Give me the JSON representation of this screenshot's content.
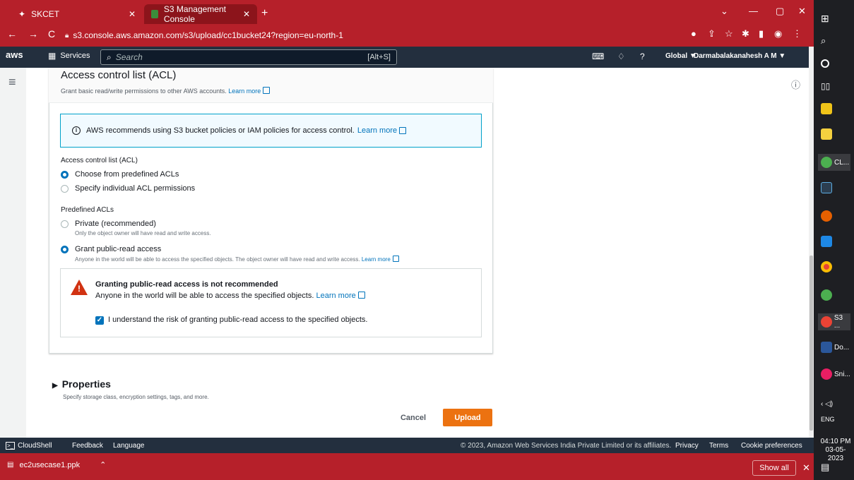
{
  "browser": {
    "tabs": [
      {
        "label": "SKCET"
      },
      {
        "label": "S3 Management Console"
      }
    ],
    "url": "s3.console.aws.amazon.com/s3/upload/cc1bucket24?region=eu-north-1"
  },
  "aws_nav": {
    "logo": "aws",
    "services_label": "Services",
    "search_placeholder": "Search",
    "search_shortcut": "[Alt+S]",
    "region": "Global ▼",
    "user": "Darmabalakanahesh A M ▼"
  },
  "acl": {
    "title": "Access control list (ACL)",
    "description": "Grant basic read/write permissions to other AWS accounts.",
    "learn_more": "Learn more",
    "info_text": "AWS recommends using S3 bucket policies or IAM policies for access control.",
    "acl_label": "Access control list (ACL)",
    "acl_options": [
      {
        "label": "Choose from predefined ACLs",
        "selected": true
      },
      {
        "label": "Specify individual ACL permissions",
        "selected": false
      }
    ],
    "predefined_label": "Predefined ACLs",
    "predefined_options": [
      {
        "label": "Private (recommended)",
        "sub": "Only the object owner will have read and write access.",
        "selected": false
      },
      {
        "label": "Grant public-read access",
        "sub": "Anyone in the world will be able to access the specified objects. The object owner will have read and write access.",
        "selected": true
      }
    ],
    "warning_title": "Granting public-read access is not recommended",
    "warning_text": "Anyone in the world will be able to access the specified objects.",
    "checkbox_label": "I understand the risk of granting public-read access to the specified objects.",
    "checkbox_checked": true
  },
  "properties": {
    "title": "Properties",
    "description": "Specify storage class, encryption settings, tags, and more."
  },
  "actions": {
    "cancel": "Cancel",
    "upload": "Upload"
  },
  "footer": {
    "cloudshell": "CloudShell",
    "feedback": "Feedback",
    "language": "Language",
    "copyright": "© 2023, Amazon Web Services India Private Limited or its affiliates.",
    "privacy": "Privacy",
    "terms": "Terms",
    "cookies": "Cookie preferences"
  },
  "download_bar": {
    "file": "ec2usecase1.ppk",
    "show_all": "Show all"
  },
  "taskbar": {
    "items": [
      "CL...",
      "S3 ...",
      "Do...",
      "Sni..."
    ],
    "lang": "ENG",
    "time": "04:10 PM",
    "date": "03-05-2023"
  },
  "colors": {
    "browser_red": "#b6202a",
    "aws_nav": "#232f3e",
    "upload_orange": "#ec7211",
    "link_blue": "#0073bb",
    "warning_red": "#d13212"
  }
}
